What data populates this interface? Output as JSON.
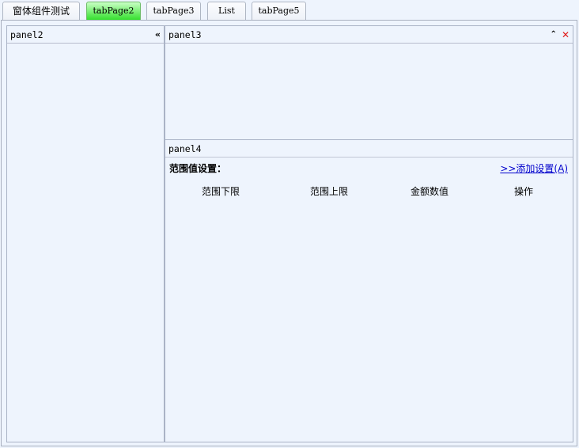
{
  "tabs": [
    {
      "label": "窗体组件测试"
    },
    {
      "label": "tabPage2"
    },
    {
      "label": "tabPage3"
    },
    {
      "label": "List"
    },
    {
      "label": "tabPage5"
    }
  ],
  "active_tab": "tabPage2",
  "panel2": {
    "title": "panel2",
    "collapse_icon": "«"
  },
  "panel3": {
    "title": "panel3",
    "collapse_icon": "⌃",
    "close_icon": "✕"
  },
  "panel4": {
    "title": "panel4",
    "section_title": "范围值设置：",
    "add_link": ">>添加设置(A)",
    "columns": [
      "范围下限",
      "范围上限",
      "金额数值",
      "操作"
    ]
  },
  "colors": {
    "background": "#eef4fd",
    "active_tab_top": "#c8ffc4",
    "active_tab_bottom": "#35e02e",
    "close_icon": "#e01a1a",
    "link": "#0000cc"
  }
}
